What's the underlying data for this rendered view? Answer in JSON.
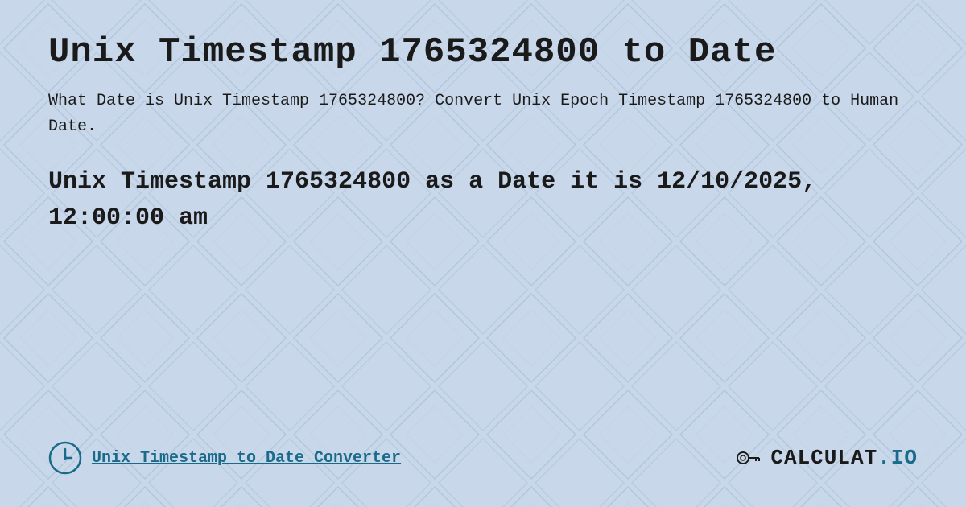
{
  "page": {
    "title": "Unix Timestamp 1765324800 to Date",
    "description": "What Date is Unix Timestamp 1765324800? Convert Unix Epoch Timestamp 1765324800 to Human Date.",
    "result": "Unix Timestamp 1765324800 as a Date it is 12/10/2025, 12:00:00 am",
    "footer_link": "Unix Timestamp to Date Converter",
    "logo": "calculat.io",
    "logo_prefix": "CALCULAT",
    "logo_suffix": ".IO"
  },
  "colors": {
    "bg": "#c8d8e8",
    "text": "#1a1a1a",
    "accent": "#1a6b8a"
  }
}
